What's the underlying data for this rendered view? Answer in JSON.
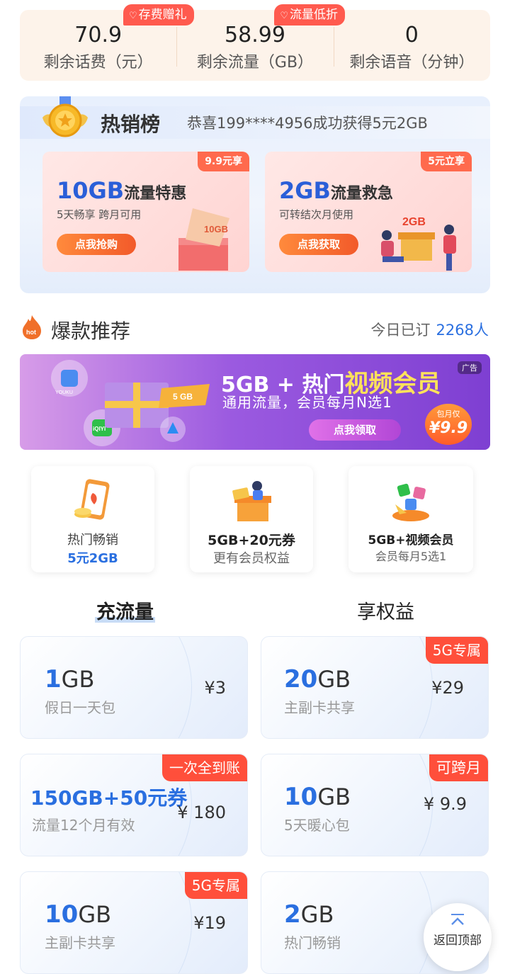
{
  "balance": [
    {
      "value": "70.9",
      "label": "剩余话费（元）",
      "tag": "存费赠礼"
    },
    {
      "value": "58.99",
      "label": "剩余流量（GB）",
      "tag": "流量低折"
    },
    {
      "value": "0",
      "label": "剩余语音（分钟）",
      "tag": ""
    }
  ],
  "hot_list": {
    "title": "热销榜",
    "news": "恭喜199****4956成功获得5元2GB",
    "cards": [
      {
        "corner": "9.9元享",
        "title_big": "10GB",
        "title_rest": "流量特惠",
        "subtitle": "5天畅享 跨月可用",
        "button": "点我抢购",
        "illus_text": "10GB"
      },
      {
        "corner": "5元立享",
        "title_big": "2GB",
        "title_rest": "流量救急",
        "subtitle": "可转结次月使用",
        "button": "点我获取",
        "illus_text": "2GB"
      }
    ]
  },
  "recommend": {
    "icon_text": "hot",
    "title": "爆款推荐",
    "count_label": "今日已订",
    "count_value": "2268人"
  },
  "banner": {
    "ad_label": "广告",
    "title_prefix": "5GB + 热门",
    "title_highlight": "视频会员",
    "subtitle": "通用流量，会员每月N选1",
    "button": "点我领取",
    "price_label": "包月仅",
    "price_value": "¥9.9",
    "tag_5gb": "5 GB",
    "youku": "YOUKU",
    "iqiyi": "iQIYI"
  },
  "tiles": [
    {
      "line1": "热门畅销",
      "line2": "5元2GB"
    },
    {
      "line1": "5GB+20元券",
      "line2": "更有会员权益"
    },
    {
      "line1": "5GB+视频会员",
      "line2": "会员每月5选1"
    }
  ],
  "tabs": [
    {
      "label": "充流量",
      "active": true
    },
    {
      "label": "享权益",
      "active": false
    }
  ],
  "packages": [
    {
      "num": "1",
      "unit": "GB",
      "subtitle": "假日一天包",
      "price": "¥3",
      "badge": ""
    },
    {
      "num": "20",
      "unit": "GB",
      "subtitle": "主副卡共享",
      "price": "¥29",
      "badge": "5G专属"
    },
    {
      "num": "150GB",
      "unit": "+50元券",
      "subtitle": "流量12个月有效",
      "price": "¥ 180",
      "badge": "一次全到账"
    },
    {
      "num": "10",
      "unit": "GB",
      "subtitle": "5天暖心包",
      "price": "¥ 9.9",
      "badge": "可跨月"
    },
    {
      "num": "10",
      "unit": "GB",
      "subtitle": "主副卡共享",
      "price": "¥19",
      "badge": "5G专属"
    },
    {
      "num": "2",
      "unit": "GB",
      "subtitle": "热门畅销",
      "price": "",
      "badge": ""
    }
  ],
  "back_to_top": "返回顶部",
  "colors": {
    "accent_blue": "#2a6fe0",
    "badge_red": "#ff4f3b",
    "tag_red": "#ff5a4e",
    "banner_purple": "#8b47d8"
  }
}
